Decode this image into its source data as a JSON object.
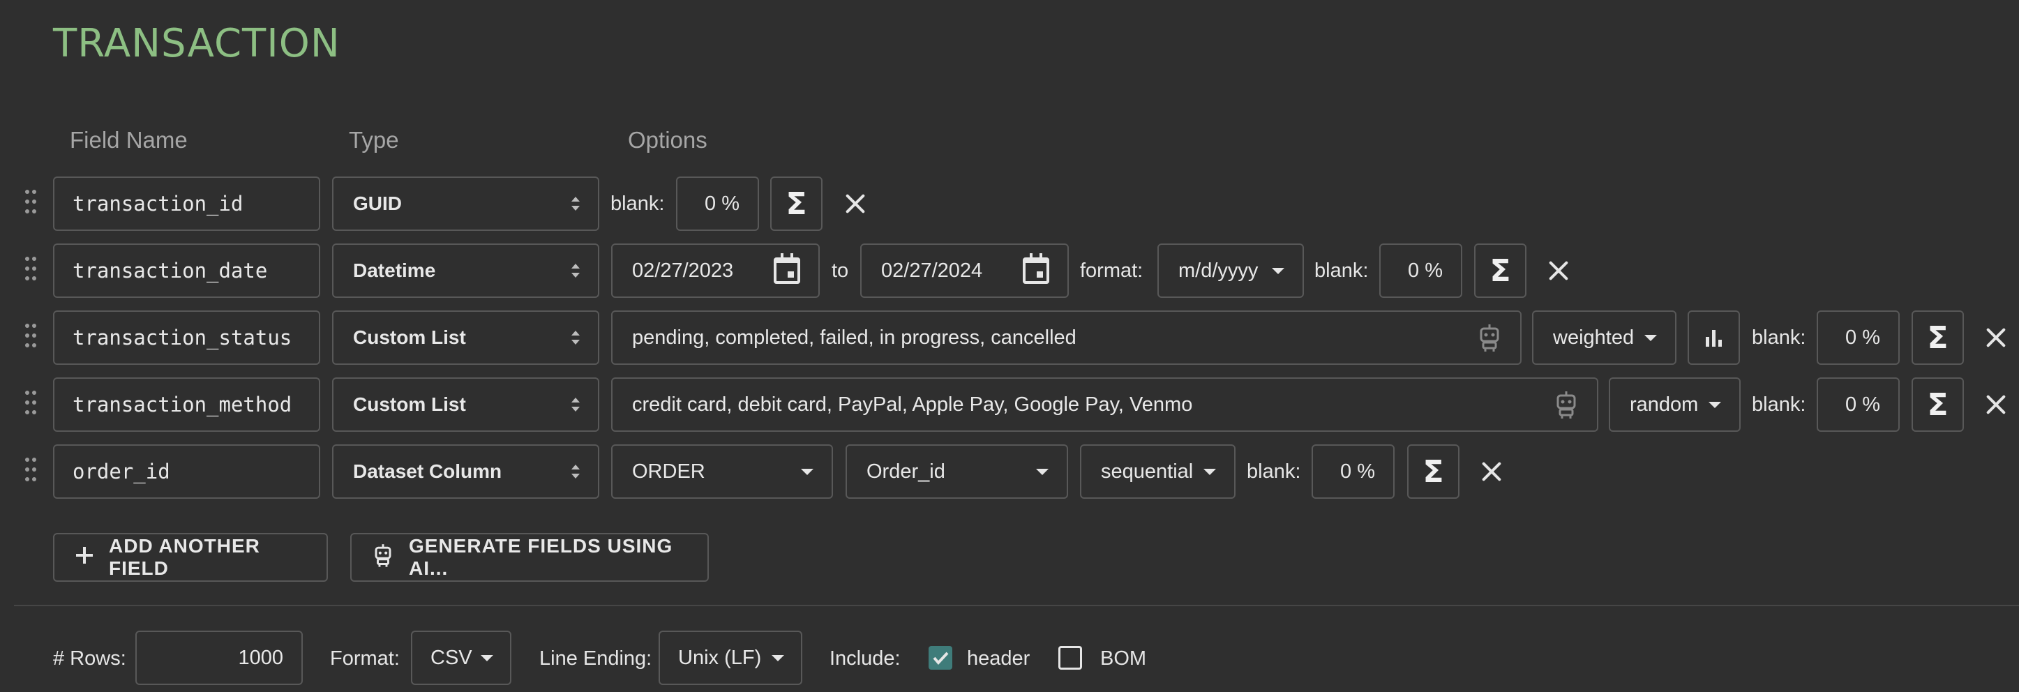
{
  "title": "TRANSACTION",
  "columns": {
    "field_name": "Field Name",
    "type": "Type",
    "options": "Options"
  },
  "fields": [
    {
      "name": "transaction_id",
      "type": "GUID",
      "blank_label": "blank:",
      "blank_value": "0 %"
    },
    {
      "name": "transaction_date",
      "type": "Datetime",
      "from": "02/27/2023",
      "to_label": "to",
      "to": "02/27/2024",
      "format_label": "format:",
      "format": "m/d/yyyy",
      "blank_label": "blank:",
      "blank_value": "0 %"
    },
    {
      "name": "transaction_status",
      "type": "Custom List",
      "values": "pending, completed, failed, in progress, cancelled",
      "distribution": "weighted",
      "blank_label": "blank:",
      "blank_value": "0 %"
    },
    {
      "name": "transaction_method",
      "type": "Custom List",
      "values": "credit card, debit card, PayPal, Apple Pay, Google Pay, Venmo",
      "distribution": "random",
      "blank_label": "blank:",
      "blank_value": "0 %"
    },
    {
      "name": "order_id",
      "type": "Dataset Column",
      "dataset": "ORDER",
      "column": "Order_id",
      "order": "sequential",
      "blank_label": "blank:",
      "blank_value": "0 %"
    }
  ],
  "actions": {
    "add_field": "ADD ANOTHER FIELD",
    "generate_ai": "GENERATE FIELDS USING AI..."
  },
  "footer": {
    "rows_label": "# Rows:",
    "rows_value": "1000",
    "format_label": "Format:",
    "format_value": "CSV",
    "line_ending_label": "Line Ending:",
    "line_ending_value": "Unix (LF)",
    "include_label": "Include:",
    "header_label": "header",
    "bom_label": "BOM"
  },
  "colors": {
    "title": "#8dbf83",
    "checkbox_on": "#3f7c7a",
    "background": "#2f2f2f"
  },
  "icons": [
    "drag-handle-icon",
    "sum-icon",
    "close-icon",
    "calendar-icon",
    "robot-icon",
    "bar-chart-icon",
    "plus-icon",
    "select-arrows-icon",
    "caret-down-icon",
    "checkbox-icon"
  ]
}
